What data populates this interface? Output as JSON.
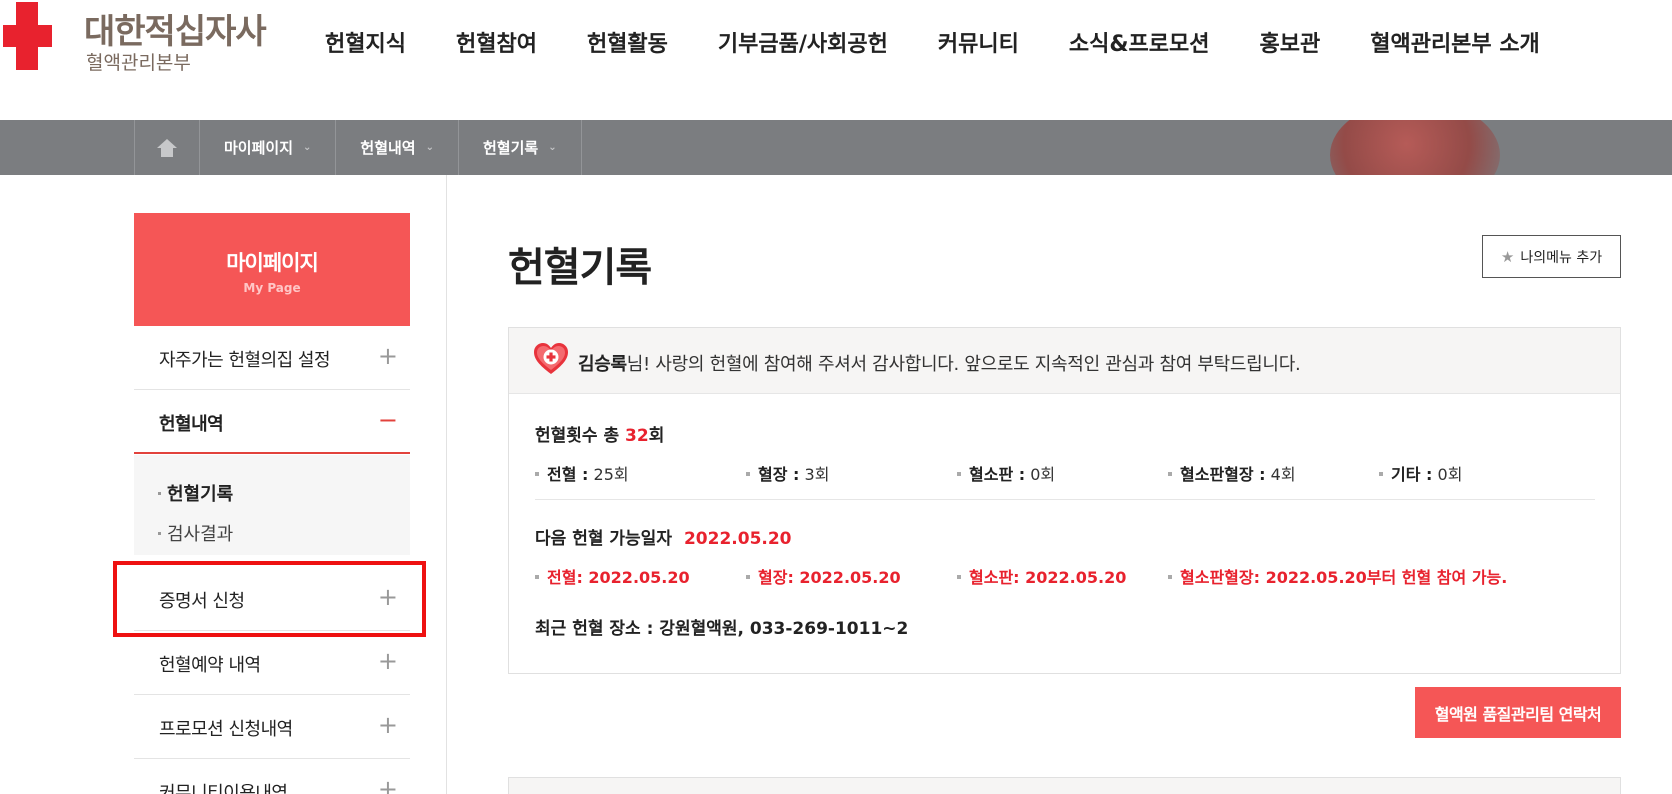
{
  "logo": {
    "name": "대한적십자사",
    "sub": "혈액관리본부"
  },
  "gnb": [
    "헌혈지식",
    "헌혈참여",
    "헌혈활동",
    "기부금품/사회공헌",
    "커뮤니티",
    "소식&프로모션",
    "홍보관",
    "혈액관리본부 소개"
  ],
  "breadcrumb": [
    "마이페이지",
    "헌혈내역",
    "헌혈기록"
  ],
  "sidebar": {
    "title": "마이페이지",
    "subtitle": "My Page",
    "items": [
      {
        "label": "자주가는 헌혈의집 설정",
        "sign": "+"
      },
      {
        "label": "헌혈내역",
        "sign": "−"
      },
      {
        "label": "증명서 신청",
        "sign": "+"
      },
      {
        "label": "헌혈예약 내역",
        "sign": "+"
      },
      {
        "label": "프로모션 신청내역",
        "sign": "+"
      },
      {
        "label": "커뮤니티이용내역",
        "sign": "+"
      }
    ],
    "sub_items": [
      "헌혈기록",
      "검사결과"
    ]
  },
  "main": {
    "title": "헌혈기록",
    "my_menu_button": "나의메뉴 추가",
    "greeting_name": "김승록",
    "greeting_text": "님! 사랑의 헌혈에 참여해 주셔서 감사합니다. 앞으로도 지속적인 관심과 참여 부탁드립니다.",
    "count_prefix": "헌혈횟수 총 ",
    "count_value": "32",
    "count_suffix": "회",
    "counts": [
      {
        "label": "전혈 :",
        "value": " 25회"
      },
      {
        "label": "혈장 :",
        "value": " 3회"
      },
      {
        "label": "혈소판 :",
        "value": " 0회"
      },
      {
        "label": "혈소판혈장 :",
        "value": " 4회"
      },
      {
        "label": "기타 :",
        "value": " 0회"
      }
    ],
    "next_label": "다음 헌혈 가능일자",
    "next_date": "2022.05.20",
    "next_items": [
      "전혈: 2022.05.20",
      "혈장: 2022.05.20",
      "혈소판: 2022.05.20",
      "혈소판혈장: 2022.05.20부터 헌혈 참여 가능."
    ],
    "recent": "최근 헌혈 장소 : 강원혈액원, 033-269-1011~2",
    "qa_button": "혈액원 품질관리팀 연락처"
  },
  "colors": {
    "accent": "#f55656",
    "red_text": "#e8222e",
    "highlight": "#ee1111"
  }
}
